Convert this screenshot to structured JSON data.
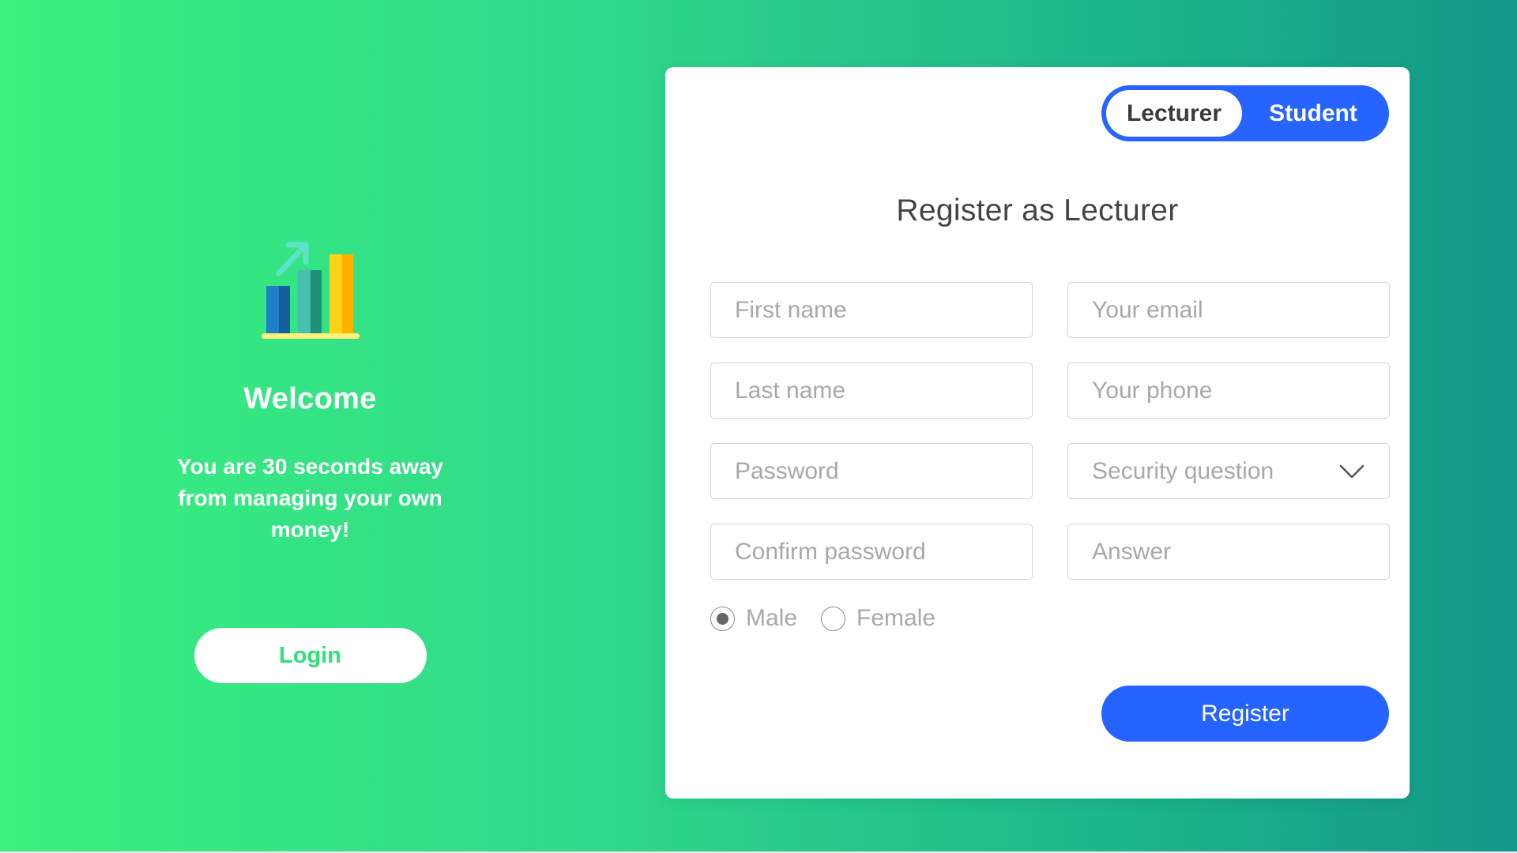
{
  "welcome": {
    "title": "Welcome",
    "tagline": "You are 30 seconds away from managing your own money!",
    "login_label": "Login",
    "logo_icon": "bar-chart-growth-icon"
  },
  "role_toggle": {
    "options": [
      "Lecturer",
      "Student"
    ],
    "selected": "Lecturer"
  },
  "form": {
    "title": "Register as Lecturer",
    "first_name_placeholder": "First name",
    "last_name_placeholder": "Last name",
    "password_placeholder": "Password",
    "confirm_password_placeholder": "Confirm password",
    "email_placeholder": "Your email",
    "phone_placeholder": "Your phone",
    "security_question_placeholder": "Security question",
    "answer_placeholder": "Answer",
    "gender_options": [
      "Male",
      "Female"
    ],
    "gender_selected": "Male",
    "register_label": "Register"
  },
  "colors": {
    "gradient_start": "#3af07e",
    "gradient_end": "#12988a",
    "accent_blue": "#2663ff",
    "login_text": "#2ee07a"
  }
}
